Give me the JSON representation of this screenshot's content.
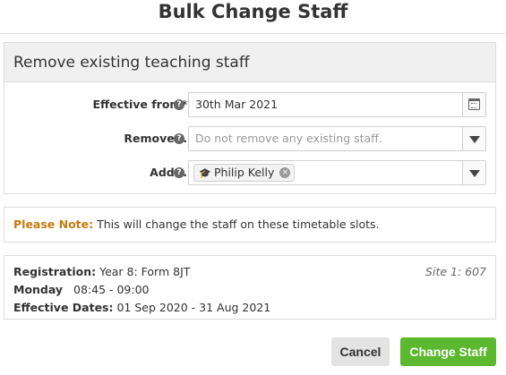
{
  "dialog": {
    "title": "Bulk Change Staff"
  },
  "form": {
    "header": "Remove existing teaching staff",
    "effective_from": {
      "label": "Effective from*",
      "value": "30th Mar 2021"
    },
    "remove": {
      "label": "Remove...",
      "placeholder": "Do not remove any existing staff."
    },
    "add": {
      "label": "Add...",
      "selected_tag": "Philip Kelly"
    },
    "help_glyph": "?"
  },
  "note": {
    "label": "Please Note:",
    "text": "This will change the staff on these timetable slots."
  },
  "slot": {
    "registration_label": "Registration:",
    "registration_value": "Year 8: Form 8JT",
    "site": "Site 1: 607",
    "day": "Monday",
    "time": "08:45 - 09:00",
    "dates_label": "Effective Dates:",
    "dates_value": "01 Sep 2020 - 31 Aug 2021"
  },
  "buttons": {
    "cancel": "Cancel",
    "change": "Change Staff"
  },
  "colors": {
    "note_label": "#c77a12",
    "primary_button": "#5cb82e",
    "secondary_button": "#e3e3e3",
    "panel_header_bg": "#f0f0f0"
  },
  "icons": {
    "date_picker": "calendar-icon",
    "dropdown": "chevron-down-icon",
    "help": "question-circle-icon",
    "staff_tag": "graduation-cap-icon",
    "remove_tag": "close-circle-icon"
  }
}
